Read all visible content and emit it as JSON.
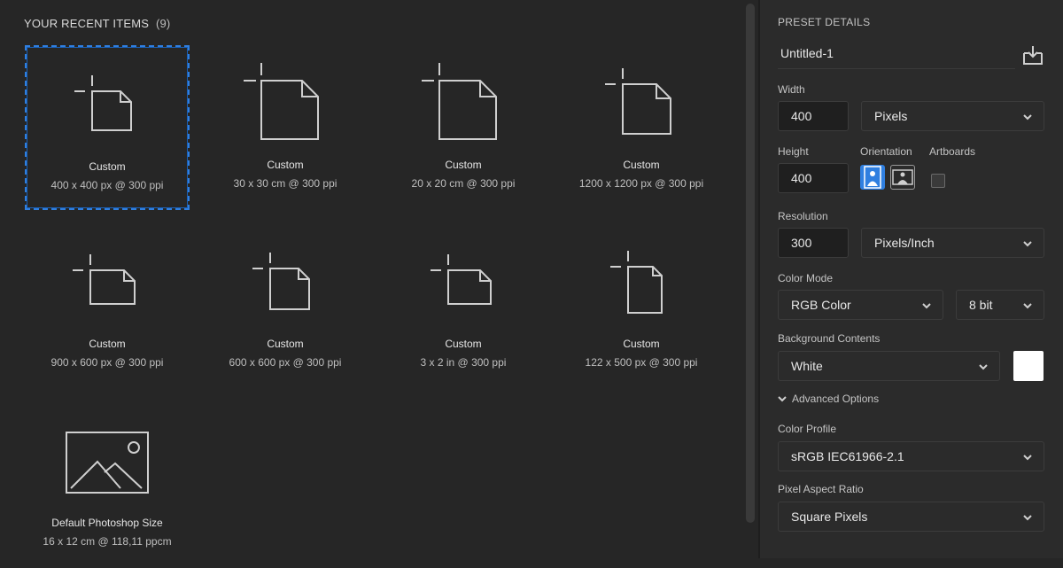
{
  "recent": {
    "title": "YOUR RECENT ITEMS",
    "count": "(9)",
    "items": [
      {
        "name": "Custom",
        "dims": "400 x 400 px @ 300 ppi"
      },
      {
        "name": "Custom",
        "dims": "30 x 30 cm @ 300 ppi"
      },
      {
        "name": "Custom",
        "dims": "20 x 20 cm @ 300 ppi"
      },
      {
        "name": "Custom",
        "dims": "1200 x 1200 px @ 300 ppi"
      },
      {
        "name": "Custom",
        "dims": "900 x 600 px @ 300 ppi"
      },
      {
        "name": "Custom",
        "dims": "600 x 600 px @ 300 ppi"
      },
      {
        "name": "Custom",
        "dims": "3 x 2 in @ 300 ppi"
      },
      {
        "name": "Custom",
        "dims": "122 x 500 px @ 300 ppi"
      },
      {
        "name": "Default Photoshop Size",
        "dims": "16 x 12 cm @ 118,11 ppcm"
      }
    ]
  },
  "preset": {
    "title": "PRESET DETAILS",
    "doc_name": "Untitled-1",
    "width_label": "Width",
    "width_value": "400",
    "width_unit": "Pixels",
    "height_label": "Height",
    "height_value": "400",
    "orientation_label": "Orientation",
    "artboards_label": "Artboards",
    "resolution_label": "Resolution",
    "resolution_value": "300",
    "resolution_unit": "Pixels/Inch",
    "color_mode_label": "Color Mode",
    "color_mode": "RGB Color",
    "bit_depth": "8 bit",
    "background_label": "Background Contents",
    "background": "White",
    "background_color": "#ffffff",
    "advanced_label": "Advanced Options",
    "profile_label": "Color Profile",
    "profile": "sRGB IEC61966-2.1",
    "aspect_label": "Pixel Aspect Ratio",
    "aspect": "Square Pixels"
  },
  "colors": {
    "accent": "#2f7fe0"
  }
}
